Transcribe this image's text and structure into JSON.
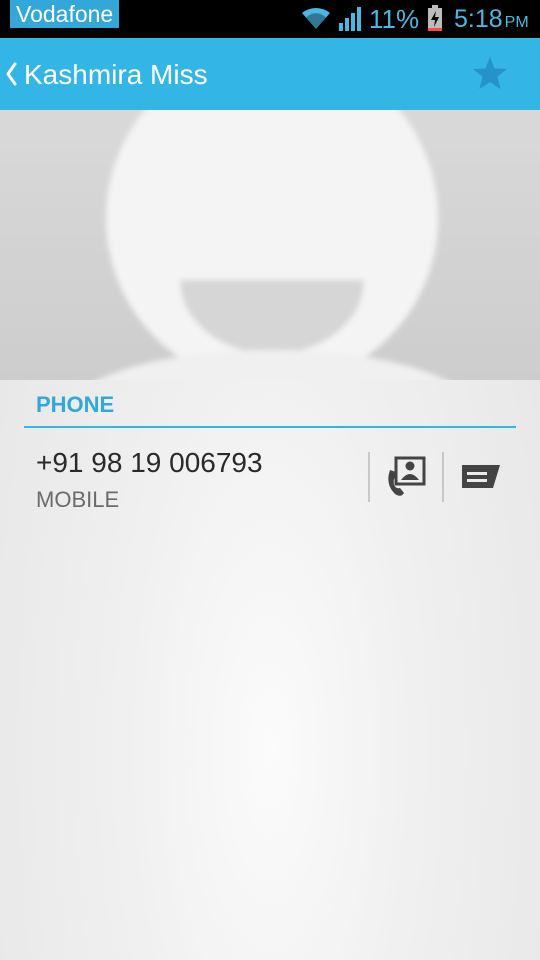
{
  "status_bar": {
    "carrier": "Vodafone",
    "battery_percent": "11%",
    "time": "5:18",
    "ampm": "PM",
    "icons": [
      "wifi-icon",
      "signal-icon",
      "battery-charging-icon"
    ],
    "accent_color": "#4ab8e2"
  },
  "action_bar": {
    "title": "Kashmira Miss",
    "back_icon": "chevron-left-icon",
    "star_icon": "star-icon",
    "color": "#33b5e5"
  },
  "photo": {
    "icon": "default-contact-avatar"
  },
  "phone_section": {
    "header": "PHONE",
    "entries": [
      {
        "number": "+91 98 19 006793",
        "type": "MOBILE",
        "actions": [
          "call-icon",
          "message-icon"
        ]
      }
    ]
  }
}
